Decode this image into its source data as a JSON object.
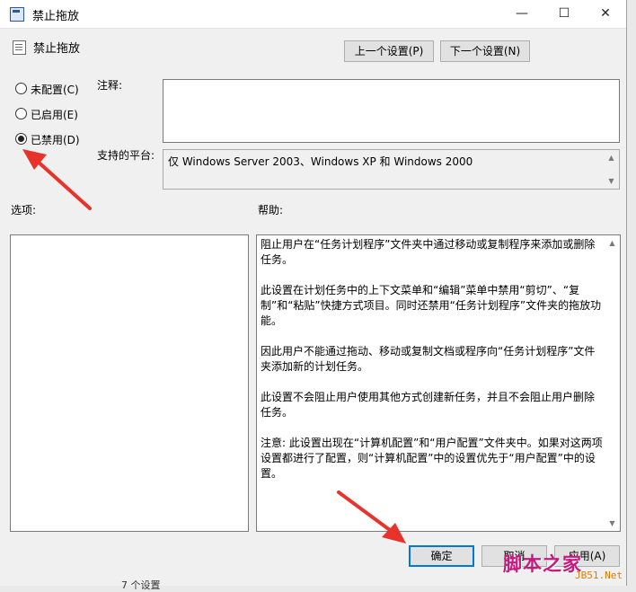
{
  "window": {
    "title": "禁止拖放",
    "policy_name": "禁止拖放",
    "controls": {
      "minimize": "—",
      "maximize": "☐",
      "close": "✕"
    }
  },
  "nav": {
    "prev_label": "上一个设置(P)",
    "next_label": "下一个设置(N)"
  },
  "state": {
    "options": [
      {
        "label": "未配置(C)",
        "checked": false
      },
      {
        "label": "已启用(E)",
        "checked": false
      },
      {
        "label": "已禁用(D)",
        "checked": true
      }
    ]
  },
  "fields": {
    "comment_label": "注释:",
    "comment_value": "",
    "platform_label": "支持的平台:",
    "platform_value": "仅 Windows Server 2003、Windows XP 和 Windows 2000"
  },
  "panes": {
    "options_label": "选项:",
    "help_label": "帮助:",
    "help_paragraphs": [
      "阻止用户在“任务计划程序”文件夹中通过移动或复制程序来添加或删除任务。",
      "此设置在计划任务中的上下文菜单和“编辑”菜单中禁用“剪切”、“复制”和“粘贴”快捷方式项目。同时还禁用“任务计划程序”文件夹的拖放功能。",
      "因此用户不能通过拖动、移动或复制文档或程序向“任务计划程序”文件夹添加新的计划任务。",
      "此设置不会阻止用户使用其他方式创建新任务，并且不会阻止用户删除任务。",
      "注意: 此设置出现在“计算机配置”和“用户配置”文件夹中。如果对这两项设置都进行了配置，则“计算机配置”中的设置优先于“用户配置”中的设置。"
    ]
  },
  "footer": {
    "ok_label": "确定",
    "cancel_label": "取消",
    "apply_label": "应用(A)"
  },
  "watermark": {
    "text": "脚本之家",
    "sub": "JB51.Net"
  },
  "background_peek": "7 个设置",
  "colors": {
    "annotation_arrow": "#e8332a",
    "focus_border": "#0078d7",
    "watermark": "#c5197d"
  }
}
